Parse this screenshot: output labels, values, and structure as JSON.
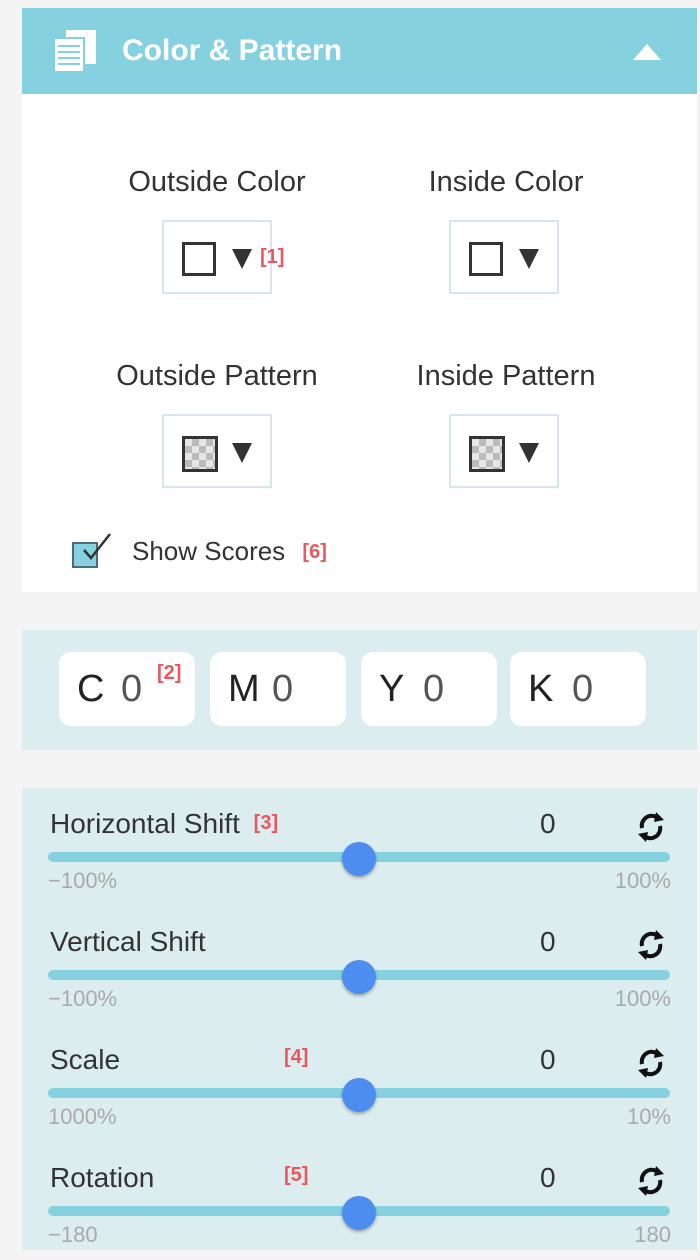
{
  "header": {
    "title": "Color & Pattern",
    "icon": "pages-icon",
    "collapse_icon": "caret-up-icon",
    "background": "#86d1e0"
  },
  "swatches": [
    {
      "label": "Outside Color",
      "kind": "color",
      "marker": "[1]"
    },
    {
      "label": "Inside Color",
      "kind": "color",
      "marker": ""
    },
    {
      "label": "Outside Pattern",
      "kind": "pattern",
      "marker": ""
    },
    {
      "label": "Inside Pattern",
      "kind": "pattern",
      "marker": ""
    }
  ],
  "show_scores": {
    "label": "Show Scores",
    "checked": true,
    "marker": "[6]"
  },
  "cmyk": {
    "marker": "[2]",
    "fields": [
      {
        "letter": "C",
        "value": "0"
      },
      {
        "letter": "M",
        "value": "0"
      },
      {
        "letter": "Y",
        "value": "0"
      },
      {
        "letter": "K",
        "value": "0"
      }
    ]
  },
  "sliders": [
    {
      "label": "Horizontal Shift",
      "marker": "[3]",
      "value": "0",
      "min": "−100%",
      "max": "100%",
      "position": 0.5
    },
    {
      "label": "Vertical Shift",
      "marker": "",
      "value": "0",
      "min": "−100%",
      "max": "100%",
      "position": 0.5
    },
    {
      "label": "Scale",
      "marker": "[4]",
      "value": "0",
      "min": "1000%",
      "max": "10%",
      "position": 0.5
    },
    {
      "label": "Rotation",
      "marker": "[5]",
      "value": "0",
      "min": "−180",
      "max": "180",
      "position": 0.5
    }
  ],
  "colors": {
    "accent": "#86d1e0",
    "panel": "#dcedf0",
    "thumb": "#4d8def",
    "marker": "#e8585e"
  }
}
